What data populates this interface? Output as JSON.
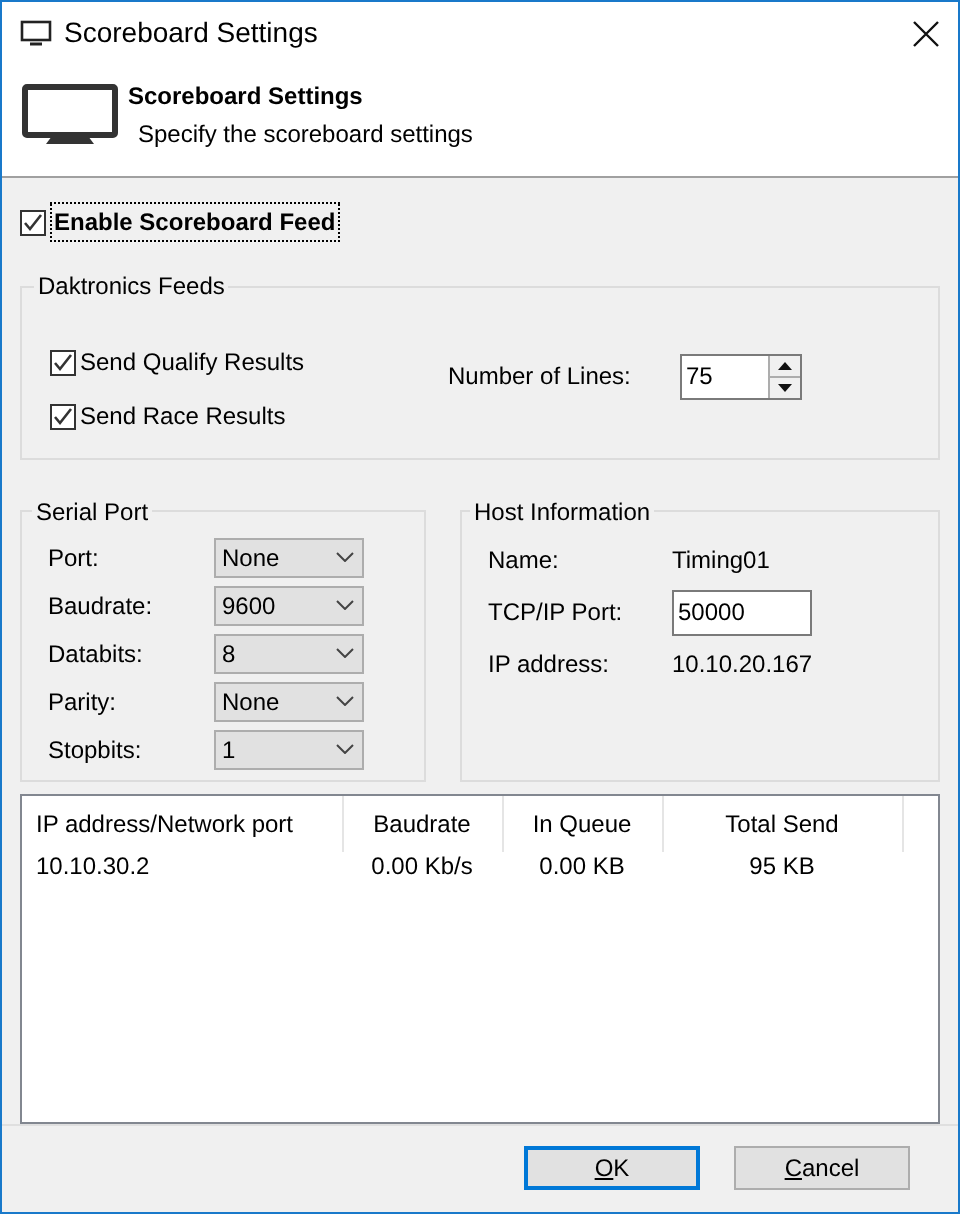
{
  "window": {
    "title": "Scoreboard Settings"
  },
  "header": {
    "title": "Scoreboard Settings",
    "subtitle": "Specify the scoreboard settings"
  },
  "enable_feed": {
    "label": "Enable Scoreboard Feed",
    "checked": true,
    "focused": true
  },
  "daktronics_feeds": {
    "title": "Daktronics Feeds",
    "options": [
      {
        "label": "Send Qualify Results",
        "checked": true
      },
      {
        "label": "Send Race Results",
        "checked": true
      }
    ],
    "lines": {
      "label": "Number of Lines:",
      "value": "75"
    }
  },
  "serial_port": {
    "title": "Serial Port",
    "fields": [
      {
        "label": "Port:",
        "value": "None"
      },
      {
        "label": "Baudrate:",
        "value": "9600"
      },
      {
        "label": "Databits:",
        "value": "8"
      },
      {
        "label": "Parity:",
        "value": "None"
      },
      {
        "label": "Stopbits:",
        "value": "1"
      }
    ]
  },
  "host_information": {
    "title": "Host Information",
    "rows": [
      {
        "kind": "text",
        "label": "Name:",
        "value": "Timing01"
      },
      {
        "kind": "input",
        "label": "TCP/IP Port:",
        "value": "50000"
      },
      {
        "kind": "text",
        "label": "IP address:",
        "value": "10.10.20.167"
      }
    ]
  },
  "connections": {
    "columns": [
      "IP address/Network port",
      "Baudrate",
      "In Queue",
      "Total Send"
    ],
    "rows": [
      [
        "10.10.30.2",
        "0.00 Kb/s",
        "0.00 KB",
        "95 KB"
      ]
    ]
  },
  "buttons": [
    {
      "label": "OK",
      "default": true
    },
    {
      "label": "Cancel",
      "default": false
    }
  ]
}
